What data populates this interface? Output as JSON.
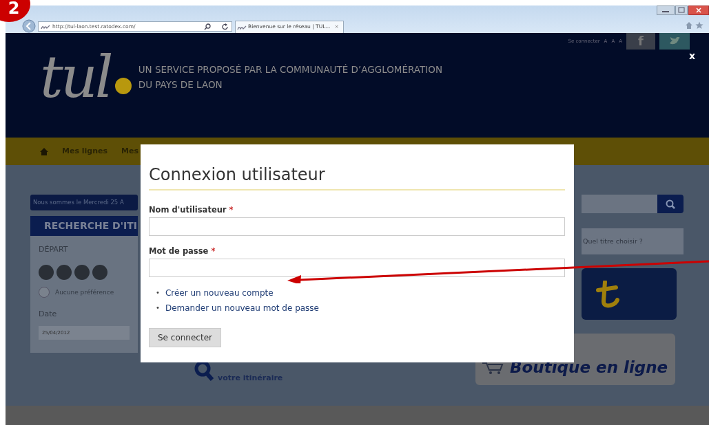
{
  "annotation": {
    "step": "2"
  },
  "browser": {
    "address": "http://tul-laon.test.ratodex.com/",
    "tab_title": "Bienvenue sur le réseau | TUL...",
    "tab_close": "×"
  },
  "site": {
    "top_links": [
      "Se connecter",
      "A",
      "A",
      "A"
    ],
    "social": [
      "f"
    ],
    "logo": "tul",
    "tagline": [
      "UN SERVICE PROPOSÉ PAR LA COMMUNAUTÉ D’AGGLOMÉRATION",
      "DU PAYS DE LAON"
    ],
    "overlay_close": "x"
  },
  "nav": {
    "items": [
      {
        "label": "Mes lignes"
      },
      {
        "label": "Mes"
      }
    ]
  },
  "itinerary": {
    "date_banner": "Nous sommes le Mercredi 25 A",
    "title": "RECHERCHE D'ITI",
    "departure_label": "DÉPART",
    "options": [
      {
        "label": "Aucune préférence",
        "selected": false
      }
    ],
    "date_label": "Date",
    "date_value": "25/04/2012"
  },
  "sidebar": {
    "help_link": "Quel titre choisir ?",
    "shop": "Boutique en ligne",
    "finder_caption": "votre itinéraire"
  },
  "modal": {
    "title": "Connexion utilisateur",
    "fields": [
      {
        "label": "Nom d'utilisateur",
        "required_mark": "*"
      },
      {
        "label": "Mot de passe",
        "required_mark": "*"
      }
    ],
    "links": [
      {
        "marker": "•",
        "text": "Créer un nouveau compte"
      },
      {
        "marker": "•",
        "text": "Demander un nouveau mot de passe"
      }
    ],
    "submit": "Se connecter"
  }
}
